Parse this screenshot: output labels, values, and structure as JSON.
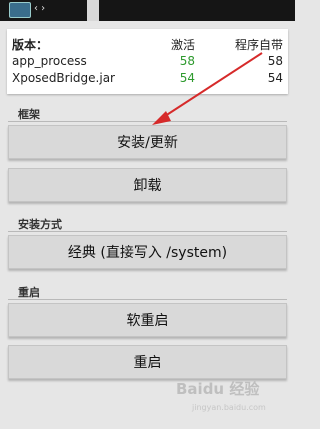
{
  "info": {
    "header": {
      "name": "版本：",
      "active": "激活",
      "bundled": "程序自带"
    },
    "rows": [
      {
        "name": "app_process",
        "active": "58",
        "bundled": "58"
      },
      {
        "name": "XposedBridge.jar",
        "active": "54",
        "bundled": "54"
      }
    ]
  },
  "sections": {
    "framework": {
      "title": "框架",
      "buttons": {
        "install": "安装/更新",
        "uninstall": "卸载"
      }
    },
    "install_method": {
      "title": "安装方式",
      "selected": "经典 (直接写入 /system)"
    },
    "reboot": {
      "title": "重启",
      "buttons": {
        "soft": "软重启",
        "reboot": "重启"
      }
    }
  },
  "watermark": {
    "text": "Baidu 经验",
    "sub": "jingyan.baidu.com"
  },
  "colors": {
    "active_value": "#2e9a2e",
    "annotation_arrow": "#d62a2a",
    "background": "#e6e6e6"
  },
  "icons": {
    "app": "xposed-app-icon",
    "nav": "chevron-icon"
  }
}
